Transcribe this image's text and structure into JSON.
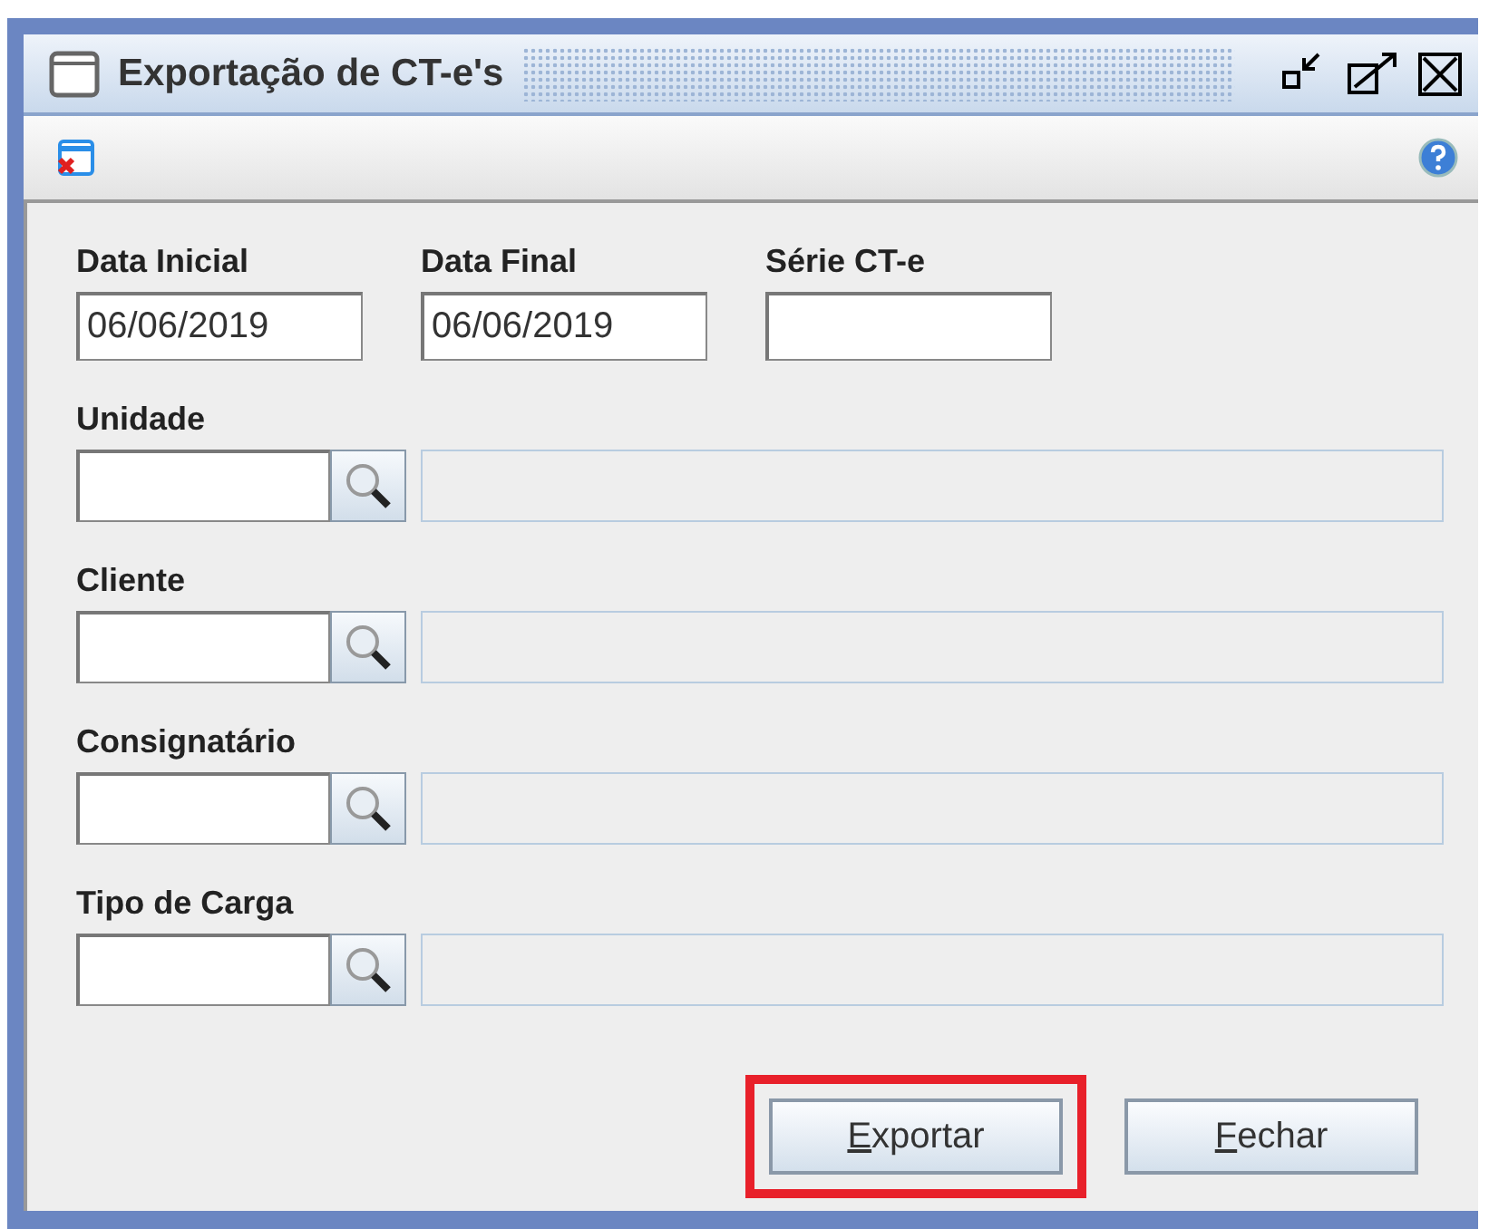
{
  "window": {
    "title": "Exportação de CT-e's"
  },
  "date_fields": [
    {
      "label": "Data Inicial",
      "value": "06/06/2019"
    },
    {
      "label": "Data Final",
      "value": "06/06/2019"
    },
    {
      "label": "Série CT-e"
    }
  ],
  "lookups": [
    {
      "label": "Unidade"
    },
    {
      "label": "Cliente"
    },
    {
      "label": "Consignatário"
    },
    {
      "label": "Tipo de Carga"
    }
  ],
  "buttons": [
    {
      "label": "Exportar",
      "mnemonic_underlined": true,
      "highlighted": true
    },
    {
      "label": "Fechar",
      "mnemonic_underlined": true,
      "highlighted": false
    }
  ]
}
